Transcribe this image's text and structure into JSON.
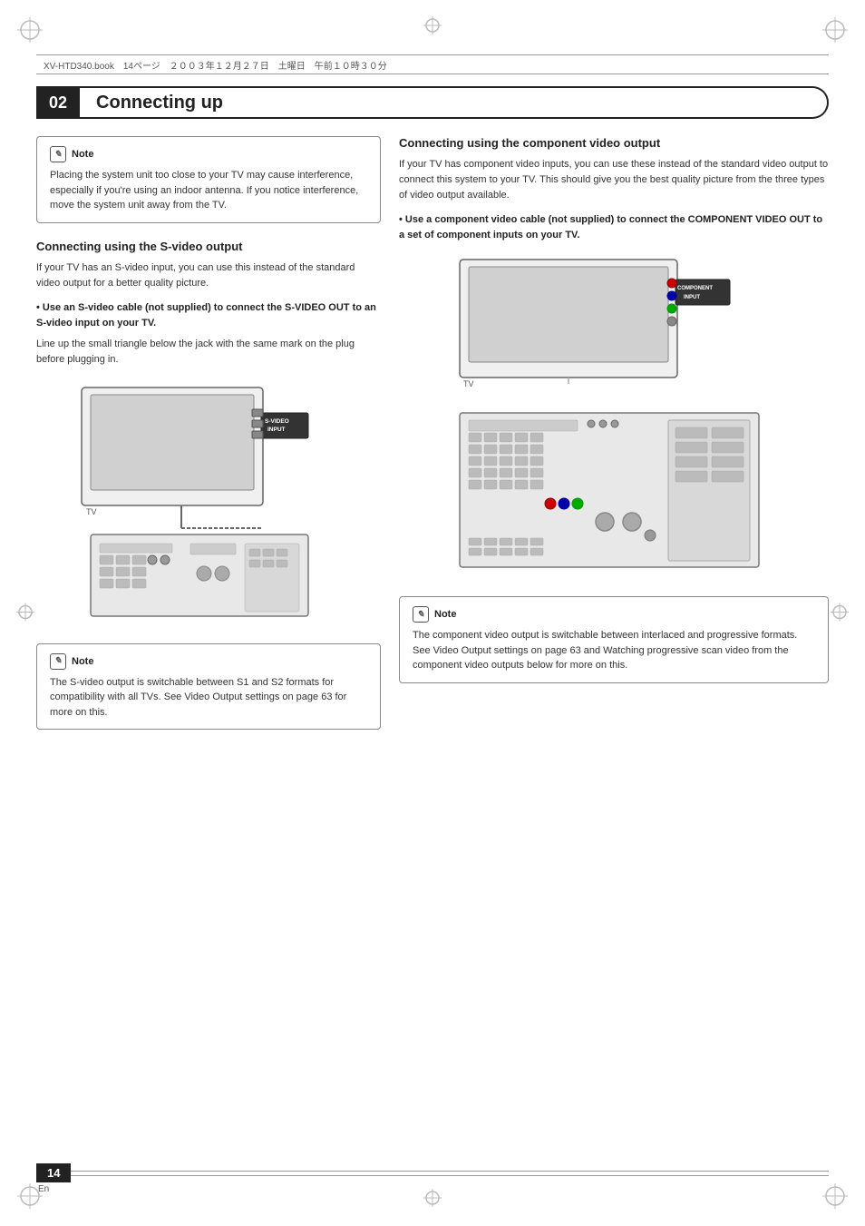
{
  "header": {
    "file_info": "XV-HTD340.book　14ページ　２００３年１２月２７日　土曜日　午前１０時３０分"
  },
  "chapter": {
    "number": "02",
    "title": "Connecting up"
  },
  "left_column": {
    "note1": {
      "label": "Note",
      "text": "Placing the system unit too close to your TV may cause interference, especially if you're using an indoor antenna. If you notice interference, move the system unit away from the TV."
    },
    "svideo_section": {
      "heading": "Connecting using the S-video output",
      "body": "If your TV has an S-video input, you can use this instead of the standard video output for a better quality picture.",
      "bullet": "Use an S-video cable (not supplied) to connect the S-VIDEO OUT to an S-video input on your TV.",
      "instruction": "Line up the small triangle below the jack with the same mark on the plug before plugging in.",
      "diagram_label": "TV",
      "svideo_label": "S-VIDEO\nINPUT"
    },
    "note2": {
      "label": "Note",
      "text": "The S-video output is switchable between S1 and S2 formats for compatibility with all TVs. See Video Output settings on page 63 for more on this."
    }
  },
  "right_column": {
    "component_section": {
      "heading": "Connecting using the component video output",
      "body": "If your TV has component video inputs, you can use these instead of the standard video output to connect this system to your TV. This should give you the best quality picture from the three types of video output available.",
      "bullet": "Use a component video cable (not supplied) to connect the COMPONENT VIDEO OUT to a set of component inputs on your TV.",
      "diagram_label": "TV",
      "component_label": "COMPONENT\nINPUT"
    },
    "note3": {
      "label": "Note",
      "text": "The component video output is switchable between interlaced and progressive formats. See Video Output settings on page 63 and Watching progressive scan video from the component video outputs below for more on this."
    }
  },
  "footer": {
    "page_number": "14",
    "lang": "En"
  }
}
